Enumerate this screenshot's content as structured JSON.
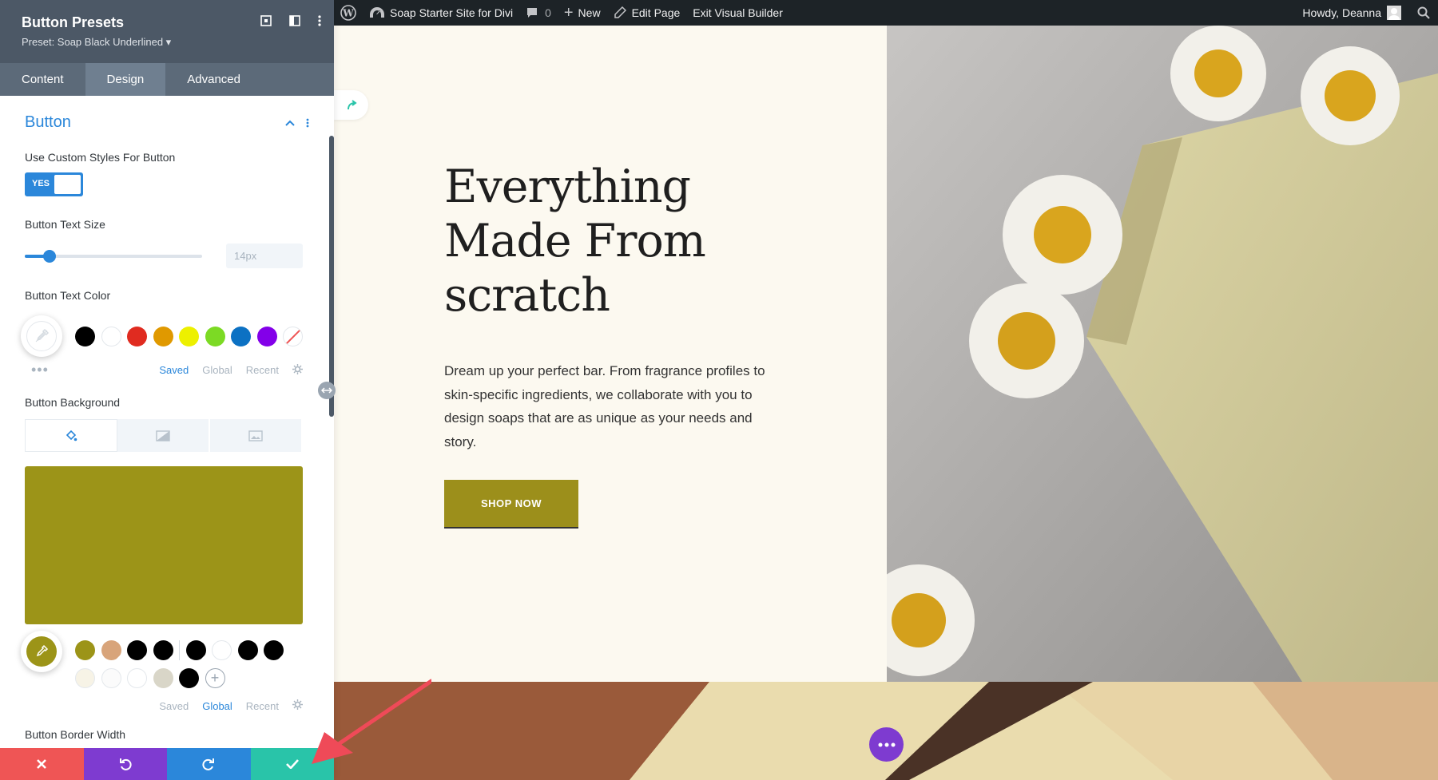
{
  "adminbar": {
    "site_name": "Soap Starter Site for Divi",
    "comments_count": "0",
    "new_label": "New",
    "edit_page_label": "Edit Page",
    "exit_label": "Exit Visual Builder",
    "howdy": "Howdy, Deanna"
  },
  "panel": {
    "title": "Button Presets",
    "preset": "Preset: Soap Black Underlined ▾",
    "tabs": [
      "Content",
      "Design",
      "Advanced"
    ],
    "active_tab": "Design",
    "section_title": "Button",
    "custom_styles_label": "Use Custom Styles For Button",
    "toggle_value": "YES",
    "text_size_label": "Button Text Size",
    "text_size_value": "14px",
    "text_size_slider": 0.14,
    "text_color_label": "Button Text Color",
    "text_color_swatches": [
      "#000000",
      "#ffffff",
      "#e02b20",
      "#e09900",
      "#edf000",
      "#7cda24",
      "#0c71c3",
      "#8300e9",
      "none"
    ],
    "color_tabs_1": [
      "Saved",
      "Global",
      "Recent"
    ],
    "color_tabs_1_active": "Saved",
    "background_label": "Button Background",
    "background_color": "#9c9418",
    "bg_swatches_row1": [
      "#9c9418",
      "#d8a47a",
      "#000000",
      "#000000",
      "|",
      "#000000",
      "#ffffff",
      "#000000",
      "#000000"
    ],
    "bg_swatches_row2": [
      "#f7f3e6",
      "#fbfbfb",
      "#ffffff",
      "#d9d6c8",
      "#000000",
      "+"
    ],
    "color_tabs_2": [
      "Saved",
      "Global",
      "Recent"
    ],
    "color_tabs_2_active": "Global",
    "border_width_label": "Button Border Width"
  },
  "hero": {
    "headline": "Everything Made From scratch",
    "description": "Dream up your perfect bar. From fragrance profiles to skin-specific ingredients, we collaborate with you to design soaps that are as unique as your needs and story.",
    "button": "SHOP NOW"
  },
  "colors": {
    "panel_header": "#4c5866",
    "accent": "#2b87da",
    "cancel": "#ef5555",
    "undo": "#7e3bd0",
    "redo": "#2b87da",
    "save": "#29c4a9"
  }
}
